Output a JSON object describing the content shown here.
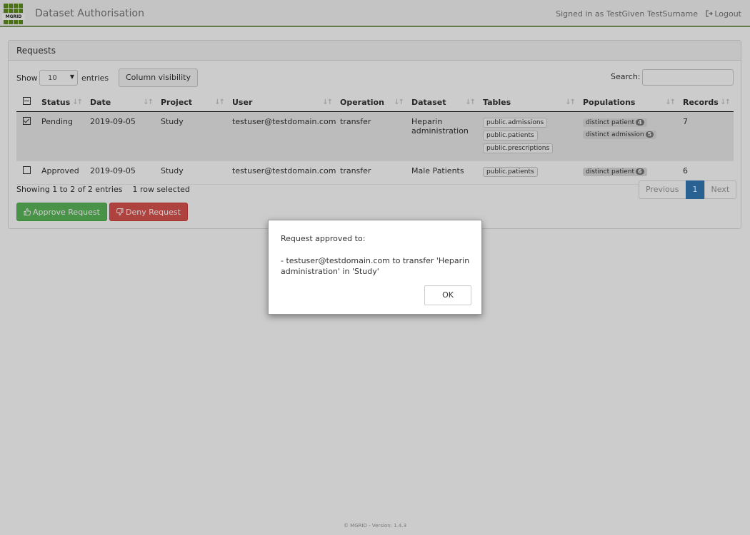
{
  "navbar": {
    "logo_text": "MGRID",
    "title": "Dataset Authorisation",
    "signed_in": "Signed in as TestGiven TestSurname",
    "logout": "Logout"
  },
  "panel": {
    "heading": "Requests",
    "show_label": "Show",
    "entries_value": "10",
    "entries_label": "entries",
    "column_visibility": "Column visibility",
    "search_label": "Search:",
    "search_value": ""
  },
  "table": {
    "headers": [
      "Status",
      "Date",
      "Project",
      "User",
      "Operation",
      "Dataset",
      "Tables",
      "Populations",
      "Records"
    ],
    "rows": [
      {
        "selected": true,
        "status": "Pending",
        "date": "2019-09-05",
        "project": "Study",
        "user": "testuser@testdomain.com",
        "operation": "transfer",
        "dataset": "Heparin administration",
        "tables": [
          "public.admissions",
          "public.patients",
          "public.prescriptions"
        ],
        "populations": [
          {
            "label": "distinct patient",
            "count": "4"
          },
          {
            "label": "distinct admission",
            "count": "5"
          }
        ],
        "records": "7"
      },
      {
        "selected": false,
        "status": "Approved",
        "date": "2019-09-05",
        "project": "Study",
        "user": "testuser@testdomain.com",
        "operation": "transfer",
        "dataset": "Male Patients",
        "tables": [
          "public.patients"
        ],
        "populations": [
          {
            "label": "distinct patient",
            "count": "6"
          }
        ],
        "records": "6"
      }
    ]
  },
  "info": {
    "showing": "Showing 1 to 2 of 2 entries",
    "selected": "1 row selected"
  },
  "pagination": {
    "previous": "Previous",
    "current": "1",
    "next": "Next"
  },
  "actions": {
    "approve": "Approve Request",
    "deny": "Deny Request"
  },
  "dialog": {
    "message": "Request approved to:",
    "item": "-  testuser@testdomain.com to transfer 'Heparin administration' in 'Study'",
    "ok": "OK"
  },
  "footer": "© MGRID - Version: 1.4.3",
  "colors": {
    "brand_green": "#5f8f1f",
    "approve": "#5cb85c",
    "deny": "#d9534f",
    "active_page": "#337ab7"
  },
  "icons": [
    "logout-icon",
    "thumbs-up-icon",
    "thumbs-down-icon",
    "sort-icon"
  ]
}
